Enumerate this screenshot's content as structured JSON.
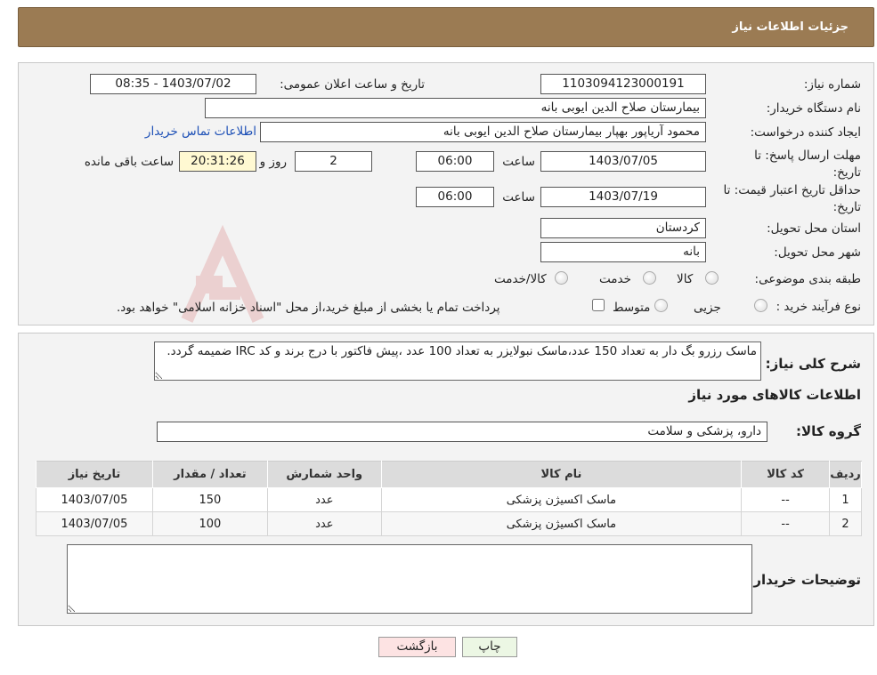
{
  "header": {
    "title": "جزئیات اطلاعات نیاز"
  },
  "labels": {
    "need_number": "شماره نیاز:",
    "announce_datetime": "تاریخ و ساعت اعلان عمومی:",
    "buyer_org": "نام دستگاه خریدار:",
    "requester": "ایجاد کننده درخواست:",
    "deadline": "مهلت ارسال پاسخ: تا تاریخ:",
    "min_validity": "حداقل تاریخ اعتبار قیمت: تا تاریخ:",
    "province": "استان محل تحویل:",
    "city": "شهر محل تحویل:",
    "category": "طبقه بندی موضوعی:",
    "process_type": "نوع فرآیند خرید :",
    "time": "ساعت",
    "days_and": "روز و",
    "remaining": "ساعت باقی مانده"
  },
  "values": {
    "need_number": "1103094123000191",
    "announce_datetime": "1403/07/02 - 08:35",
    "buyer_org": "بیمارستان صلاح الدین ایوبی بانه",
    "requester": "محمود آریاپور بهپار بیمارستان صلاح الدین ایوبی بانه",
    "contact_link": "اطلاعات تماس خریدار",
    "deadline_date": "1403/07/05",
    "deadline_time": "06:00",
    "days": "2",
    "remaining_time": "20:31:26",
    "validity_date": "1403/07/19",
    "validity_time": "06:00",
    "province": "کردستان",
    "city": "بانه"
  },
  "category_options": [
    "کالا",
    "خدمت",
    "کالا/خدمت"
  ],
  "process_options": [
    "جزیی",
    "متوسط"
  ],
  "process_note": "پرداخت تمام یا بخشی از مبلغ خرید،از محل \"اسناد خزانه اسلامی\" خواهد بود.",
  "description": {
    "label": "شرح کلی نیاز:",
    "text": "ماسک رزرو بگ دار به تعداد 150 عدد،ماسک نبولایزر به تعداد 100 عدد ،پیش فاکتور با درج برند و کد IRC ضمیمه گردد."
  },
  "goods": {
    "section_title": "اطلاعات کالاهای مورد نیاز",
    "group_label": "گروه کالا:",
    "group_value": "دارو، پزشکی و سلامت",
    "columns": [
      "ردیف",
      "کد کالا",
      "نام کالا",
      "واحد شمارش",
      "تعداد / مقدار",
      "تاریخ نیاز"
    ],
    "rows": [
      [
        "1",
        "--",
        "ماسک اکسیژن پزشکی",
        "عدد",
        "150",
        "1403/07/05"
      ],
      [
        "2",
        "--",
        "ماسک اکسیژن پزشکی",
        "عدد",
        "100",
        "1403/07/05"
      ]
    ]
  },
  "buyer_notes": {
    "label": "توضیحات خریدار:",
    "value": ""
  },
  "buttons": {
    "print": "چاپ",
    "back": "بازگشت"
  },
  "colors": {
    "header": "#9b7b53",
    "back_button": "#fde3e3",
    "print_button": "#ecf7e4",
    "remaining_box": "#fff9d2",
    "link": "#1c4fb6"
  }
}
